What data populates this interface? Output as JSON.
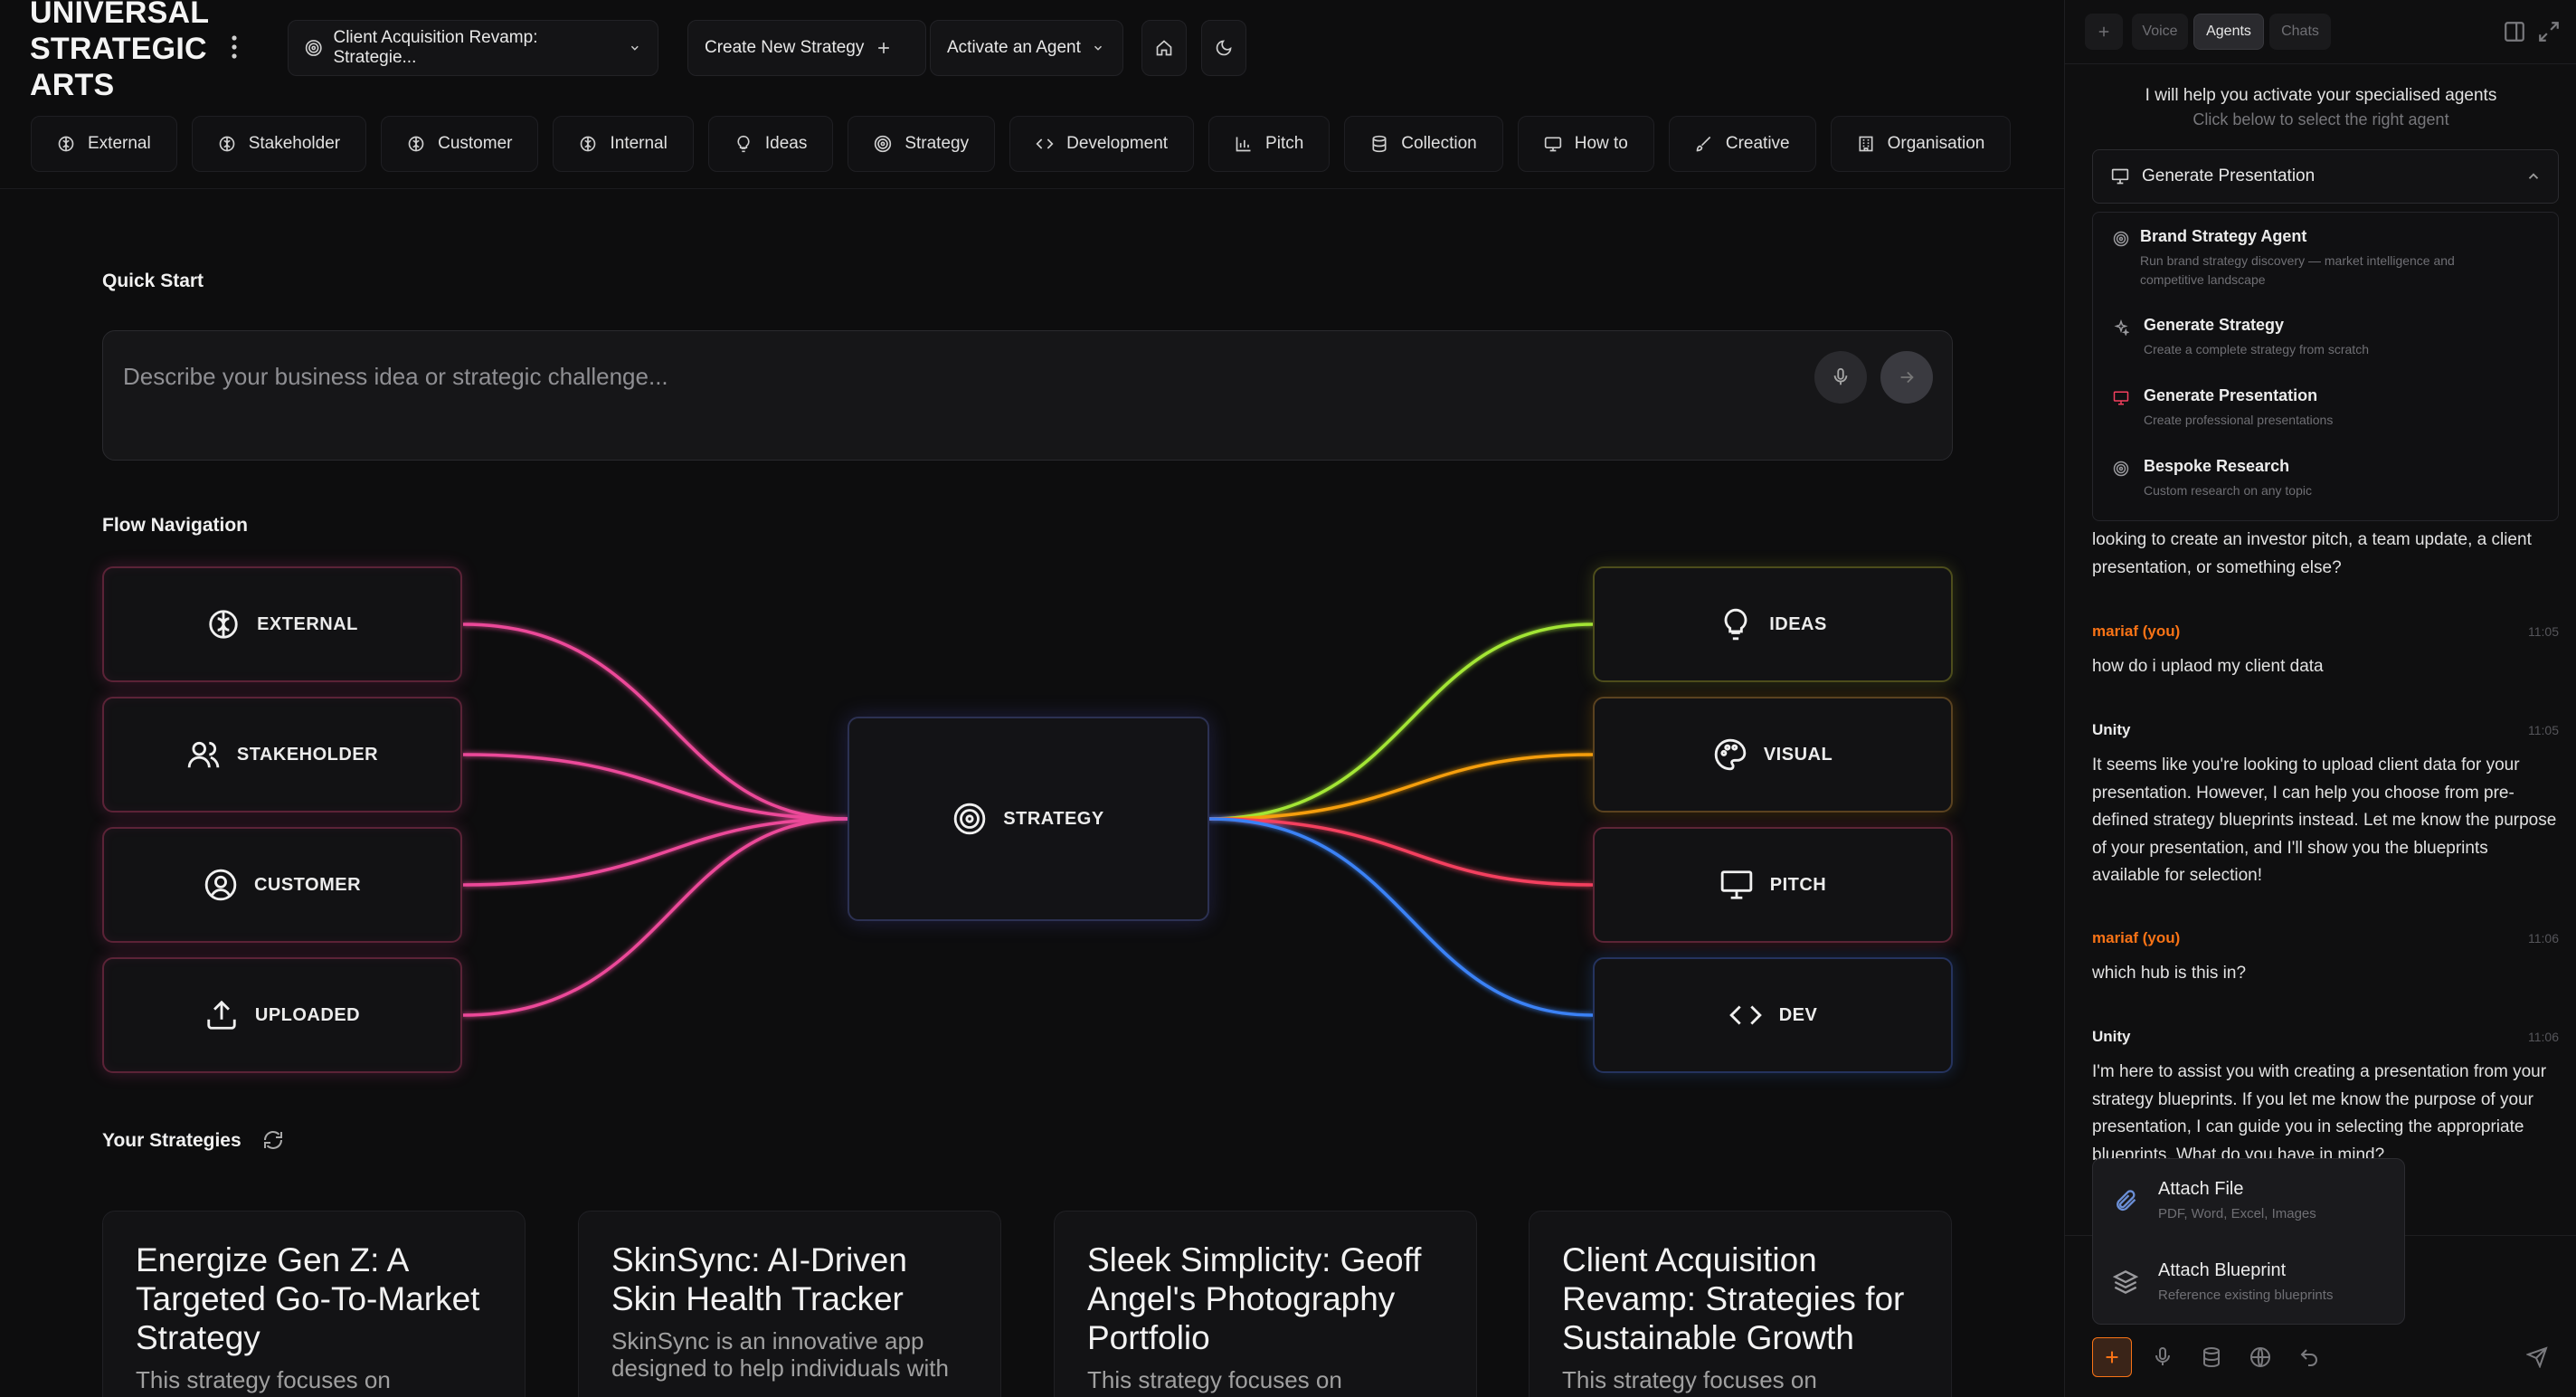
{
  "brand": {
    "line1": "UNIVERSAL",
    "line2": "STRATEGIC",
    "line3": "ARTS"
  },
  "topbar": {
    "project_label": "Client Acquisition Revamp: Strategie...",
    "create_label": "Create New Strategy",
    "activate_label": "Activate an Agent"
  },
  "nav_tabs": [
    {
      "label": "External",
      "icon": "brain-icon"
    },
    {
      "label": "Stakeholder",
      "icon": "brain-icon"
    },
    {
      "label": "Customer",
      "icon": "brain-icon"
    },
    {
      "label": "Internal",
      "icon": "brain-icon"
    },
    {
      "label": "Ideas",
      "icon": "lightbulb-icon"
    },
    {
      "label": "Strategy",
      "icon": "target-icon"
    },
    {
      "label": "Development",
      "icon": "code-icon"
    },
    {
      "label": "Pitch",
      "icon": "bar-chart-icon"
    },
    {
      "label": "Collection",
      "icon": "database-icon"
    },
    {
      "label": "How to",
      "icon": "monitor-icon"
    },
    {
      "label": "Creative",
      "icon": "brush-icon"
    },
    {
      "label": "Organisation",
      "icon": "building-icon"
    }
  ],
  "quick_start": {
    "title": "Quick Start",
    "placeholder": "Describe your business idea or strategic challenge..."
  },
  "flow": {
    "title": "Flow Navigation",
    "left_nodes": [
      {
        "label": "EXTERNAL",
        "icon": "brain-icon"
      },
      {
        "label": "STAKEHOLDER",
        "icon": "users-icon"
      },
      {
        "label": "CUSTOMER",
        "icon": "user-circle-icon"
      },
      {
        "label": "UPLOADED",
        "icon": "upload-icon"
      }
    ],
    "center_node": {
      "label": "STRATEGY",
      "icon": "target-icon"
    },
    "right_nodes": [
      {
        "label": "IDEAS",
        "icon": "lightbulb-icon",
        "color": "#a3e635"
      },
      {
        "label": "VISUAL",
        "icon": "palette-icon",
        "color": "#f59e0b"
      },
      {
        "label": "PITCH",
        "icon": "presentation-icon",
        "color": "#f43f5e"
      },
      {
        "label": "DEV",
        "icon": "code-icon",
        "color": "#3b82f6"
      }
    ],
    "left_color": "#ec4899"
  },
  "strategies": {
    "title": "Your Strategies",
    "cards": [
      {
        "title": "Energize Gen Z: A Targeted Go-To-Market Strategy",
        "desc": "This strategy focuses on"
      },
      {
        "title": "SkinSync: AI-Driven Skin Health Tracker",
        "desc": "SkinSync is an innovative app designed to help individuals with"
      },
      {
        "title": "Sleek Simplicity: Geoff Angel's Photography Portfolio",
        "desc": "This strategy focuses on"
      },
      {
        "title": "Client Acquisition Revamp: Strategies for Sustainable Growth",
        "desc": "This strategy focuses on"
      }
    ]
  },
  "panel": {
    "tabs": {
      "voice": "Voice",
      "agents": "Agents",
      "chats": "Chats"
    },
    "intro_line1": "I will help you activate your specialised agents",
    "intro_line2": "Click below to select the right agent",
    "dropdown_label": "Generate Presentation",
    "agents": [
      {
        "title": "Brand Strategy Agent",
        "desc": "Run brand strategy discovery — market intelligence and competitive landscape",
        "icon": "target-icon",
        "color": "#9a9a9e"
      },
      {
        "title": "Generate Strategy",
        "desc": "Create a complete strategy from scratch",
        "icon": "sparkle-icon",
        "color": "#9a9a9e"
      },
      {
        "title": "Generate Presentation",
        "desc": "Create professional presentations",
        "icon": "presentation-icon",
        "color": "#f43f5e"
      },
      {
        "title": "Bespoke Research",
        "desc": "Custom research on any topic",
        "icon": "target-icon",
        "color": "#9a9a9e"
      }
    ],
    "chat_continuation": "looking to create an investor pitch, a team update, a client presentation, or something else?",
    "messages": [
      {
        "author": "mariaf (you)",
        "time": "11:05",
        "text": "how do i uplaod my client data",
        "is_user": true
      },
      {
        "author": "Unity",
        "time": "11:05",
        "text": "It seems like you're looking to upload client data for your presentation. However, I can help you choose from pre-defined strategy blueprints instead. Let me know the purpose of your presentation, and I'll show you the blueprints available for selection!",
        "is_user": false
      },
      {
        "author": "mariaf (you)",
        "time": "11:06",
        "text": "which hub is this in?",
        "is_user": true
      },
      {
        "author": "Unity",
        "time": "11:06",
        "text": "I'm here to assist you with creating a presentation from your strategy blueprints. If you let me know the purpose of your presentation, I can guide you in selecting the appropriate blueprints. What do you have in mind?",
        "is_user": false
      }
    ],
    "attach_menu": [
      {
        "title": "Attach File",
        "desc": "PDF, Word, Excel, Images",
        "icon": "paperclip-icon"
      },
      {
        "title": "Attach Blueprint",
        "desc": "Reference existing blueprints",
        "icon": "layers-icon"
      }
    ],
    "accent": "#f97316"
  }
}
